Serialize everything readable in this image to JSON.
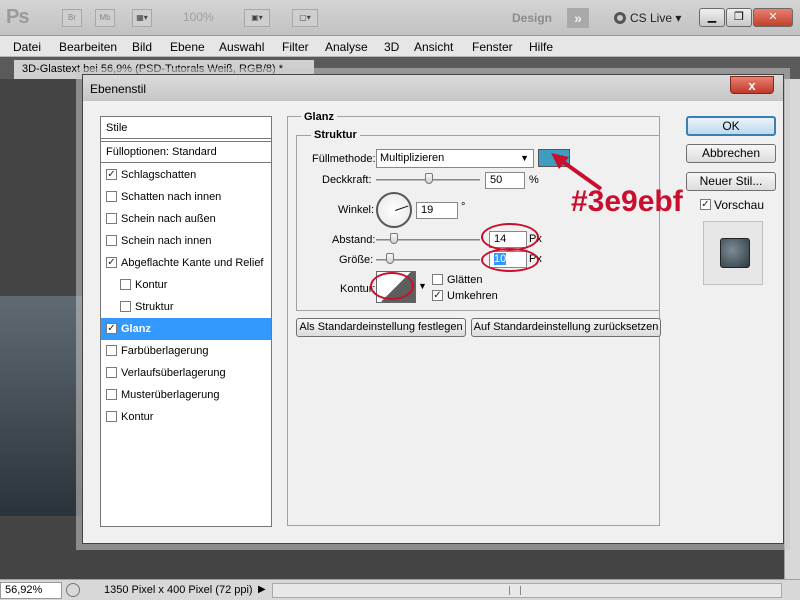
{
  "appbar": {
    "logo": "Ps",
    "bridge_label": "Br",
    "minibridge_label": "Mb",
    "zoom": "100%",
    "workspace": "Design",
    "cslive": "CS Live"
  },
  "menu": [
    "Datei",
    "Bearbeiten",
    "Bild",
    "Ebene",
    "Auswahl",
    "Filter",
    "Analyse",
    "3D",
    "Ansicht",
    "Fenster",
    "Hilfe"
  ],
  "document_tab": "3D-Glastext bei 56,9% (PSD-Tutorals Weiß, RGB/8) *",
  "statusbar": {
    "zoom": "56,92%",
    "info": "1350 Pixel x 400 Pixel (72 ppi)"
  },
  "dialog": {
    "title": "Ebenenstil",
    "close_label": "x",
    "styles_header": "Stile",
    "blend_options": "Fülloptionen: Standard",
    "styles": [
      {
        "label": "Schlagschatten",
        "checked": true
      },
      {
        "label": "Schatten nach innen",
        "checked": false
      },
      {
        "label": "Schein nach außen",
        "checked": false
      },
      {
        "label": "Schein nach innen",
        "checked": false
      },
      {
        "label": "Abgeflachte Kante und Relief",
        "checked": true
      },
      {
        "label": "Kontur",
        "checked": false
      },
      {
        "label": "Struktur",
        "checked": false
      },
      {
        "label": "Glanz",
        "checked": true
      },
      {
        "label": "Farbüberlagerung",
        "checked": false
      },
      {
        "label": "Verlaufsüberlagerung",
        "checked": false
      },
      {
        "label": "Musterüberlagerung",
        "checked": false
      },
      {
        "label": "Kontur",
        "checked": false
      }
    ],
    "glanz": {
      "section_title": "Glanz",
      "group_title": "Struktur",
      "blend_mode_label": "Füllmethode:",
      "blend_mode_value": "Multiplizieren",
      "color": "#3e9ebf",
      "opacity_label": "Deckkraft:",
      "opacity_value": "50",
      "opacity_unit": "%",
      "angle_label": "Winkel:",
      "angle_value": "19",
      "angle_unit": "°",
      "distance_label": "Abstand:",
      "distance_value": "14",
      "distance_unit": "Px",
      "size_label": "Größe:",
      "size_value": "10",
      "size_unit": "Px",
      "contour_label": "Kontur:",
      "smooth_label": "Glätten",
      "smooth_checked": false,
      "invert_label": "Umkehren",
      "invert_checked": true,
      "make_default": "Als Standardeinstellung festlegen",
      "reset_default": "Auf Standardeinstellung zurücksetzen"
    },
    "buttons": {
      "ok": "OK",
      "cancel": "Abbrechen",
      "new_style": "Neuer Stil...",
      "preview": "Vorschau",
      "preview_checked": true
    }
  },
  "annotation": {
    "color_text": "#3e9ebf",
    "color": "#c8102e"
  }
}
